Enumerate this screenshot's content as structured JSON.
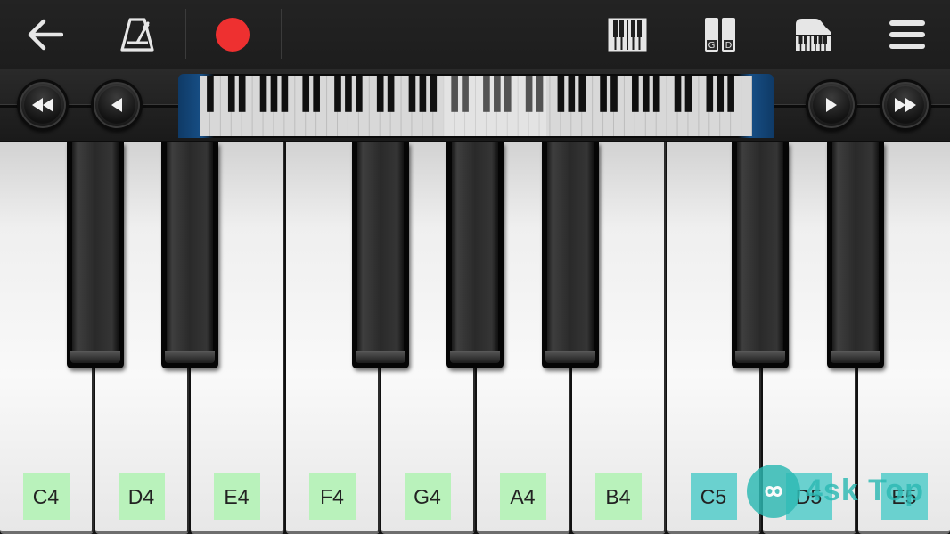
{
  "colors": {
    "record": "#ee3030",
    "label_green": "#b9f2bb",
    "label_cyan": "#6ad1cf",
    "icon": "#e6e6e6",
    "watermark": "#2cb9b3"
  },
  "toolbar": {
    "icons": [
      "back-arrow-icon",
      "metronome-icon",
      "record-icon",
      "single-keyboard-icon",
      "dual-keyboard-icon",
      "grand-piano-icon",
      "menu-icon"
    ],
    "dual_label_left": "G",
    "dual_label_right": "D"
  },
  "navigation": {
    "icons": [
      "fast-rewind-icon",
      "previous-icon",
      "next-icon",
      "fast-forward-icon"
    ]
  },
  "keyboard": {
    "white_keys": [
      {
        "note": "C4"
      },
      {
        "note": "D4"
      },
      {
        "note": "E4"
      },
      {
        "note": "F4"
      },
      {
        "note": "G4"
      },
      {
        "note": "A4"
      },
      {
        "note": "B4"
      },
      {
        "note": "C5",
        "highlight": true
      },
      {
        "note": "D5",
        "highlight": true
      },
      {
        "note": "E5",
        "highlight": true
      }
    ]
  },
  "watermark": {
    "text": "4sk Top",
    "logo": "watermark-logo-icon"
  }
}
